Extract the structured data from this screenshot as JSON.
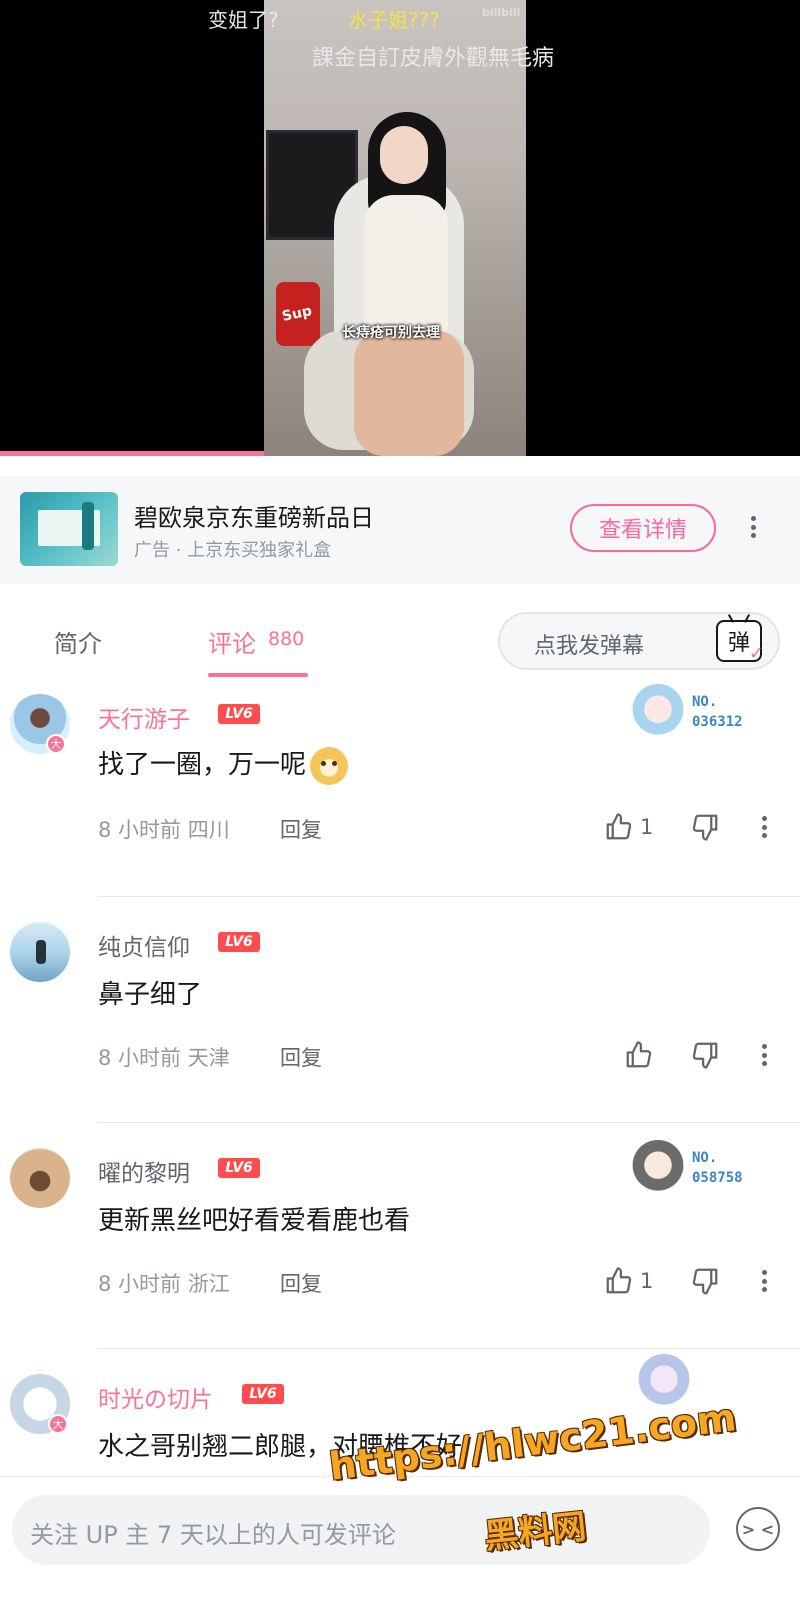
{
  "video": {
    "danmaku": [
      "变姐了?",
      "水子姐???",
      "課金自訂皮膚外觀無毛病"
    ],
    "caption": "长痔疮可别去理",
    "bili_mark": "bilibili",
    "bin_text": "Sup",
    "progress": 0.33,
    "colors": {
      "progress": "#fb7299",
      "danmaku_highlight": "#f4e24a"
    }
  },
  "ad": {
    "title": "碧欧泉京东重磅新品日",
    "subtitle": "广告 · 上京东买独家礼盒",
    "button_label": "查看详情"
  },
  "tabs": {
    "intro_label": "简介",
    "comments_label": "评论",
    "comments_count": "880",
    "danmaku_placeholder": "点我发弹幕",
    "danmaku_icon_char": "弹",
    "danmaku_icon_check": "✓"
  },
  "comments": [
    {
      "username": "天行游子",
      "level": "LV6",
      "text": "找了一圈，万一呢",
      "emoji": "doge-emoji",
      "time_location": "8 小时前  四川",
      "reply_label": "回复",
      "likes": "1",
      "vip_char": "大",
      "fan_no_label": "NO.",
      "fan_no": "036312"
    },
    {
      "username": "纯贞信仰",
      "level": "LV6",
      "text": "鼻子细了",
      "time_location": "8 小时前  天津",
      "reply_label": "回复",
      "likes": ""
    },
    {
      "username": "曜的黎明",
      "level": "LV6",
      "text": "更新黑丝吧好看爱看鹿也看",
      "time_location": "8 小时前  浙江",
      "reply_label": "回复",
      "likes": "1",
      "fan_no_label": "NO.",
      "fan_no": "058758"
    },
    {
      "username": "时光の切片",
      "level": "LV6",
      "text": "水之哥别翘二郎腿，对腰椎不好",
      "vip_char": "大"
    }
  ],
  "bottom": {
    "reply_placeholder": "关注 UP 主 7 天以上的人可发评论",
    "emoji_icon_char": "> <"
  },
  "watermark": {
    "url": "https://hlwc21.com",
    "name": "黑料网"
  }
}
